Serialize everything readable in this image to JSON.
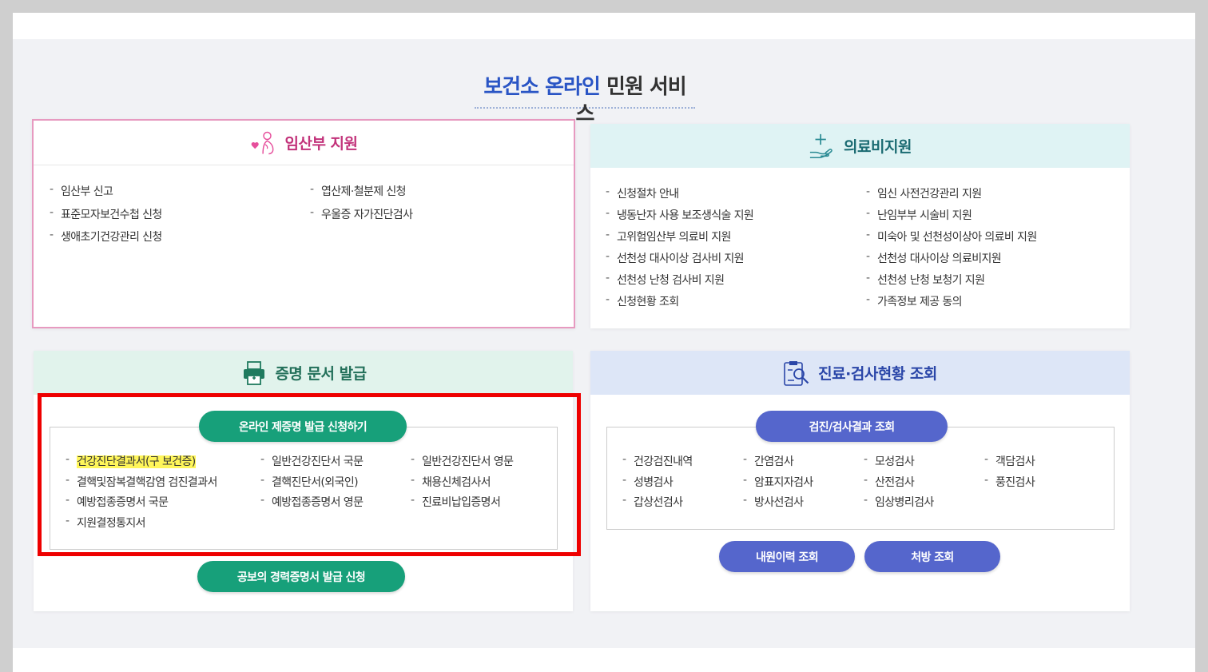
{
  "page": {
    "title_blue": "보건소 온라인",
    "title_dark": "민원 서비스",
    "colors": {
      "accent_blue": "#2a55c5",
      "green": "#17a07a",
      "pill_blue": "#5566cc",
      "highlight_red": "#ee0000",
      "highlight_yellow": "#fff65a"
    }
  },
  "pregnant": {
    "title": "임산부 지원",
    "icon": "pregnant-woman-heart-icon",
    "col1": [
      "임산부 신고",
      "표준모자보건수첩 신청",
      "생애초기건강관리 신청"
    ],
    "col2": [
      "엽산제·철분제 신청",
      "우울증 자가진단검사"
    ]
  },
  "medical": {
    "title": "의료비지원",
    "icon": "hand-plus-icon",
    "col1": [
      "신청절차 안내",
      "냉동난자 사용 보조생식술 지원",
      "고위험임산부 의료비 지원",
      "선천성 대사이상 검사비 지원",
      "선천성 난청 검사비 지원",
      "신청현황 조회"
    ],
    "col2": [
      "임신 사전건강관리 지원",
      "난임부부 시술비 지원",
      "미숙아 및 선천성이상아 의료비 지원",
      "선천성 대사이상 의료비지원",
      "선천성 난청 보청기 지원",
      "가족정보 제공 동의"
    ]
  },
  "cert": {
    "title": "증명 문서 발급",
    "icon": "printer-icon",
    "apply_button": "온라인 제증명 발급 신청하기",
    "col1": [
      "건강진단결과서(구 보건증)",
      "결핵및잠복결핵감염 검진결과서",
      "예방접종증명서 국문",
      "지원결정통지서"
    ],
    "col2": [
      "일반건강진단서 국문",
      "결핵진단서(외국인)",
      "예방접종증명서 영문"
    ],
    "col3": [
      "일반건강진단서 영문",
      "채용신체검사서",
      "진료비납입증명서"
    ],
    "career_button": "공보의 경력증명서 발급 신청"
  },
  "exam": {
    "title": "진료·검사현황 조회",
    "icon": "clipboard-search-icon",
    "result_button": "검진/검사결과 조회",
    "col1": [
      "건강검진내역",
      "성병검사",
      "갑상선검사"
    ],
    "col2": [
      "간염검사",
      "암표지자검사",
      "방사선검사"
    ],
    "col3": [
      "모성검사",
      "산전검사",
      "임상병리검사"
    ],
    "col4": [
      "객담검사",
      "풍진검사"
    ],
    "visit_button": "내원이력 조회",
    "prescription_button": "처방 조회"
  }
}
